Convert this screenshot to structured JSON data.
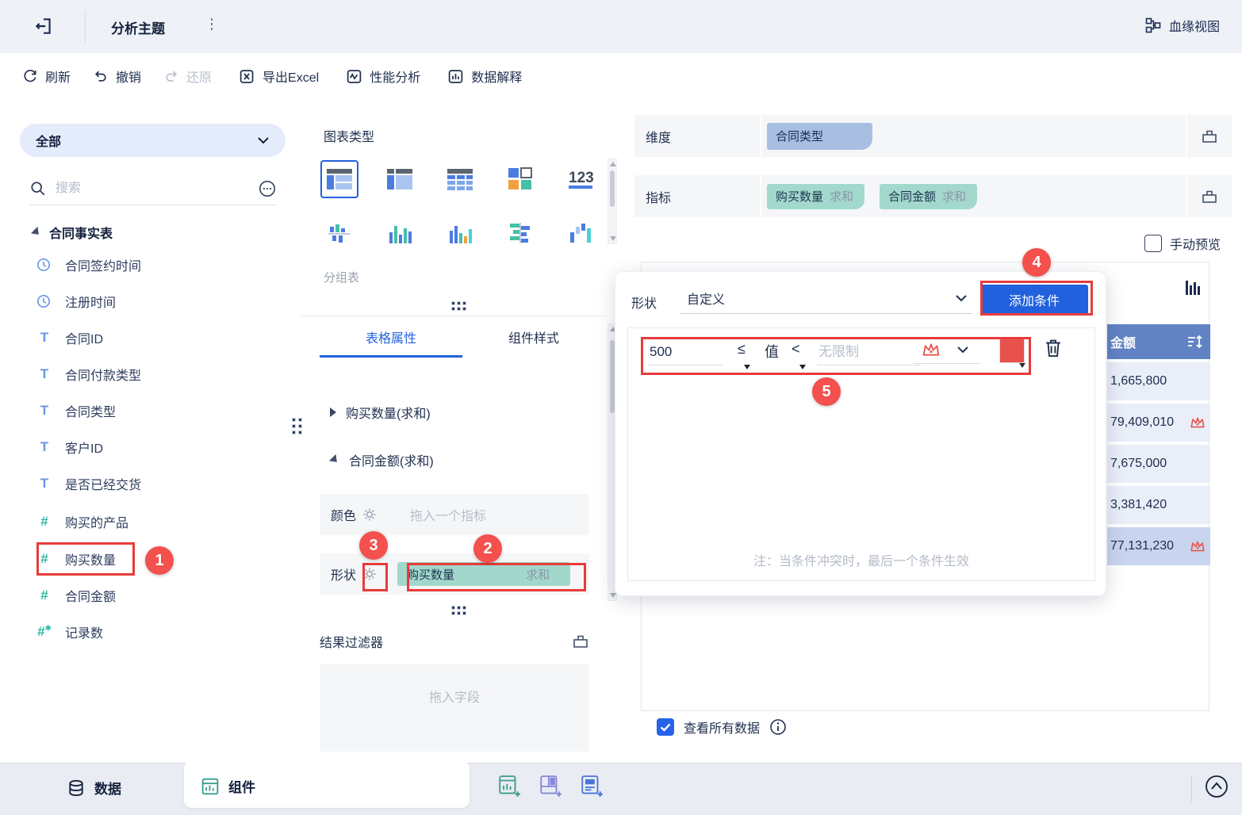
{
  "topbar": {
    "title": "分析主题",
    "lineage_label": "血缘视图"
  },
  "toolbar": {
    "refresh": "刷新",
    "undo": "撤销",
    "redo": "还原",
    "export_excel": "导出Excel",
    "performance": "性能分析",
    "explain": "数据解释"
  },
  "sidebar": {
    "scope_label": "全部",
    "search_placeholder": "搜索",
    "table_name": "合同事实表",
    "fields": [
      {
        "label": "合同签约时间",
        "type": "date"
      },
      {
        "label": "注册时间",
        "type": "date"
      },
      {
        "label": "合同ID",
        "type": "text"
      },
      {
        "label": "合同付款类型",
        "type": "text"
      },
      {
        "label": "合同类型",
        "type": "text"
      },
      {
        "label": "客户ID",
        "type": "text"
      },
      {
        "label": "是否已经交货",
        "type": "text"
      },
      {
        "label": "购买的产品",
        "type": "number"
      },
      {
        "label": "购买数量",
        "type": "number"
      },
      {
        "label": "合同金额",
        "type": "number"
      },
      {
        "label": "记录数",
        "type": "number-calc"
      }
    ]
  },
  "middle": {
    "chart_type_title": "图表类型",
    "selected_chart_name": "分组表",
    "tabs": [
      {
        "label": "表格属性"
      },
      {
        "label": "组件样式"
      }
    ],
    "aggregates": [
      {
        "label": "购买数量(求和)"
      },
      {
        "label": "合同金额(求和)"
      }
    ],
    "color_label": "颜色",
    "color_placeholder": "拖入一个指标",
    "shape_label": "形状",
    "shape_field": {
      "name": "购买数量",
      "agg": "求和"
    },
    "result_filter_title": "结果过滤器",
    "result_filter_placeholder": "拖入字段"
  },
  "right": {
    "dimension_label": "维度",
    "dimension_fields": [
      {
        "name": "合同类型"
      }
    ],
    "measure_label": "指标",
    "measure_fields": [
      {
        "name": "购买数量",
        "agg": "求和"
      },
      {
        "name": "合同金额",
        "agg": "求和"
      }
    ],
    "manual_preview_label": "手动预览",
    "table": {
      "header": "金额",
      "rows": [
        {
          "value": "1,665,800",
          "crown": false
        },
        {
          "value": "79,409,010",
          "crown": true
        },
        {
          "value": "7,675,000",
          "crown": false
        },
        {
          "value": "3,381,420",
          "crown": false
        },
        {
          "value": "77,131,230",
          "crown": true
        }
      ]
    },
    "view_all_label": "查看所有数据"
  },
  "popup": {
    "shape_label": "形状",
    "shape_mode": "自定义",
    "add_condition_label": "添加条件",
    "condition": {
      "min": "500",
      "op1": "≤",
      "value_label": "值",
      "op2": "<",
      "max_placeholder": "无限制"
    },
    "note": "注：当条件冲突时，最后一个条件生效"
  },
  "bottombar": {
    "data_tab": "数据",
    "component_tab": "组件"
  },
  "annotations": {
    "badges": [
      "1",
      "2",
      "3",
      "4",
      "5"
    ]
  },
  "colors": {
    "accent_blue": "#2161dd",
    "annotation_red": "#e83b3b",
    "badge_red": "#f4504d",
    "teal_pill": "#a2d8cc",
    "dimension_pill": "#a9bee3",
    "table_header_blue": "#6183c4",
    "row_blue": "#e9eef8",
    "row_selected": "#c9d5ef",
    "crown_red": "#e8564f",
    "swatch_red": "#e8524d",
    "field_icon_blue": "#6a96e8",
    "field_icon_teal": "#2cb8a4"
  }
}
